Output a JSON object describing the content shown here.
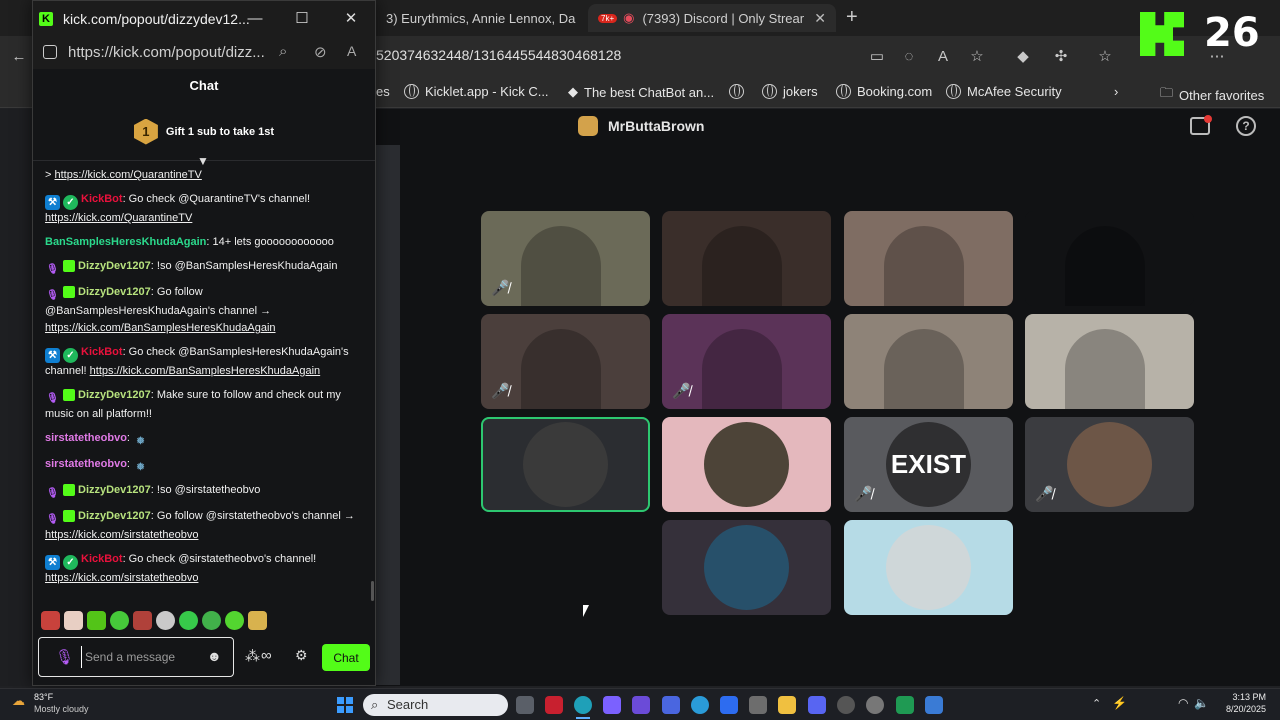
{
  "browser": {
    "tabs": [
      {
        "label": "3) Eurythmics, Annie Lennox, Da"
      },
      {
        "label": "(7393) Discord | Only Stream"
      }
    ],
    "tab_badge": "7k+",
    "url_tail": "520374632448/1316445544830468128",
    "bookmarks": [
      {
        "label": "es"
      },
      {
        "label": "Kicklet.app - Kick C..."
      },
      {
        "label": "The best ChatBot an..."
      },
      {
        "label": ""
      },
      {
        "label": "jokers"
      },
      {
        "label": "Booking.com"
      },
      {
        "label": "McAfee Security"
      }
    ],
    "other_favorites": "Other favorites"
  },
  "popout": {
    "title": "kick.com/popout/dizzydev12...",
    "url": "https://kick.com/popout/dizz...",
    "chat_header": "Chat",
    "gift_badge": "1",
    "gift_text": "Gift 1 sub to take 1st",
    "messages": [
      {
        "badges": [],
        "user": "",
        "user_color": "#f0f0f0",
        "text": "> ",
        "link": "https://kick.com/QuarantineTV"
      },
      {
        "badges": [
          "mod",
          "ver"
        ],
        "user": "KickBot",
        "user_color": "#e9113c",
        "text": ": Go check @QuarantineTV's channel! ",
        "link": "https://kick.com/QuarantineTV"
      },
      {
        "badges": [],
        "user": "BanSamplesHeresKhudaAgain",
        "user_color": "#2bd98c",
        "text": ": 14+ lets goooooooooooo",
        "link": ""
      },
      {
        "badges": [
          "mic",
          "sub"
        ],
        "user": "DizzyDev1207",
        "user_color": "#b7e27e",
        "text": ": !so @BanSamplesHeresKhudaAgain",
        "link": ""
      },
      {
        "badges": [
          "mic",
          "sub"
        ],
        "user": "DizzyDev1207",
        "user_color": "#b7e27e",
        "text": ": Go follow @BanSamplesHeresKhudaAgain's channel → ",
        "link": "https://kick.com/BanSamplesHeresKhudaAgain"
      },
      {
        "badges": [
          "mod",
          "ver"
        ],
        "user": "KickBot",
        "user_color": "#e9113c",
        "text": ": Go check @BanSamplesHeresKhudaAgain's channel! ",
        "link": "https://kick.com/BanSamplesHeresKhudaAgain"
      },
      {
        "badges": [
          "mic",
          "sub"
        ],
        "user": "DizzyDev1207",
        "user_color": "#b7e27e",
        "text": ": Make sure to follow and check out my music on all platform!!",
        "link": ""
      },
      {
        "badges": [],
        "user": "sirstatetheobvo",
        "user_color": "#e07ae6",
        "text": ": ",
        "link": "",
        "leaf": true
      },
      {
        "badges": [],
        "user": "sirstatetheobvo",
        "user_color": "#e07ae6",
        "text": ": ",
        "link": "",
        "leaf": true
      },
      {
        "badges": [
          "mic",
          "sub"
        ],
        "user": "DizzyDev1207",
        "user_color": "#b7e27e",
        "text": ": !so @sirstatetheobvo",
        "link": ""
      },
      {
        "badges": [
          "mic",
          "sub"
        ],
        "user": "DizzyDev1207",
        "user_color": "#b7e27e",
        "text": ": Go follow @sirstatetheobvo's channel → ",
        "link": "https://kick.com/sirstatetheobvo"
      },
      {
        "badges": [
          "mod",
          "ver"
        ],
        "user": "KickBot",
        "user_color": "#e9113c",
        "text": ": Go check @sirstatetheobvo's channel! ",
        "link": "https://kick.com/sirstatetheobvo"
      }
    ],
    "input_placeholder": "Send a message",
    "chat_button": "Chat"
  },
  "discord": {
    "channel_name": "MrButtaBrown",
    "tiles": [
      {
        "bg": "#6b6a58",
        "muted": true,
        "type": "video"
      },
      {
        "bg": "#3a2e2a",
        "muted": false,
        "type": "video"
      },
      {
        "bg": "#7f6d63",
        "muted": false,
        "type": "video"
      },
      {
        "bg": "#111214",
        "muted": false,
        "type": "video"
      },
      {
        "bg": "#4b3f3c",
        "muted": true,
        "type": "video"
      },
      {
        "bg": "#5b3358",
        "muted": true,
        "type": "video"
      },
      {
        "bg": "#8e8378",
        "muted": false,
        "type": "video"
      },
      {
        "bg": "#b7b2a8",
        "muted": false,
        "type": "video"
      },
      {
        "bg": "#2b2d31",
        "muted": false,
        "type": "avatar",
        "avatar": "#3a3a3a",
        "speaking": true
      },
      {
        "bg": "#e4b8bd",
        "muted": false,
        "type": "avatar",
        "avatar": "#4d4438"
      },
      {
        "bg": "#595a5e",
        "muted": true,
        "type": "avatar",
        "avatar": "#2f2f31",
        "label": "EXIST"
      },
      {
        "bg": "#3b3c40",
        "muted": true,
        "type": "avatar",
        "avatar": "#6d5647"
      },
      {
        "bg": "#35303a",
        "muted": false,
        "type": "avatar",
        "avatar": "#27506a"
      },
      {
        "bg": "#b6dbe6",
        "muted": false,
        "type": "avatar",
        "avatar": "#cfd7d9"
      }
    ]
  },
  "overlay": {
    "number": "26"
  },
  "taskbar": {
    "weather_temp": "83°F",
    "weather_desc": "Mostly cloudy",
    "search_label": "Search",
    "time": "3:13 PM",
    "date": "8/20/2025"
  },
  "colors": {
    "kick_green": "#53fc18",
    "kickbot_red": "#e9113c"
  }
}
